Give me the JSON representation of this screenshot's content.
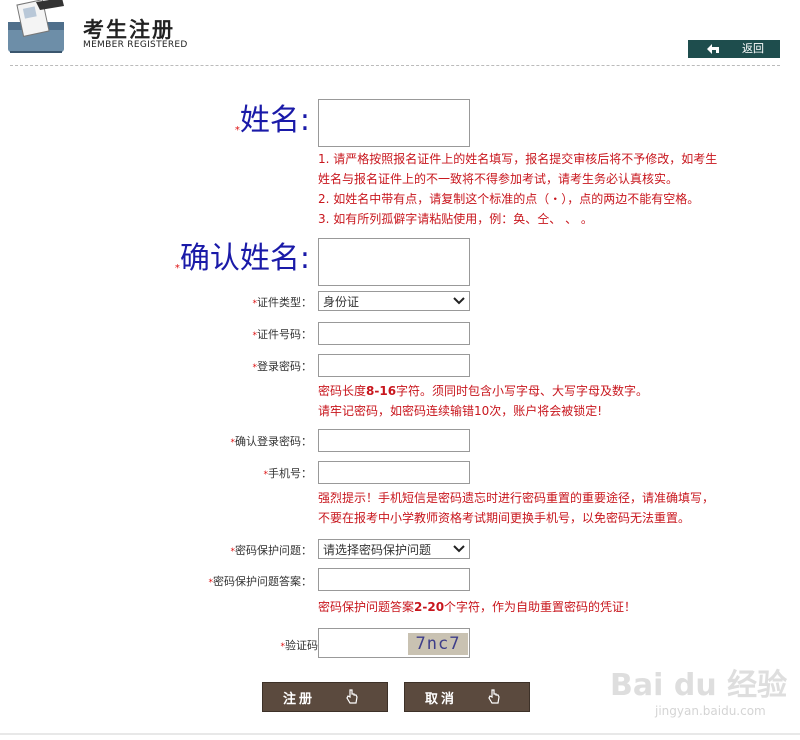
{
  "header": {
    "title_cn": "考生注册",
    "title_en": "MEMBER REGISTERED",
    "back_label": "返回"
  },
  "form": {
    "name": {
      "label": "姓名:",
      "value": "",
      "notes": [
        "1. 请严格按照报名证件上的姓名填写，报名提交审核后将不予修改，如考生",
        "姓名与报名证件上的不一致将不得参加考试，请考生务必认真核实。",
        "2. 如姓名中带有点，请复制这个标准的点（・），点的两边不能有空格。",
        "3. 如有所列孤僻字请粘贴使用，例：奂、仝、  、  。"
      ]
    },
    "confirm_name": {
      "label": "确认姓名:",
      "value": ""
    },
    "id_type": {
      "label": "证件类型：",
      "selected": "身份证"
    },
    "id_number": {
      "label": "证件号码：",
      "value": ""
    },
    "password": {
      "label": "登录密码：",
      "value": "",
      "note_line1_pre": "密码长度",
      "note_line1_bold": "8-16",
      "note_line1_post": "字符。须同时包含小写字母、大写字母及数字。",
      "note_line2": "请牢记密码，如密码连续输错10次，账户将会被锁定!"
    },
    "confirm_password": {
      "label": "确认登录密码：",
      "value": ""
    },
    "phone": {
      "label": "手机号：",
      "value": "",
      "notes": [
        "强烈提示！手机短信是密码遗忘时进行密码重置的重要途径，请准确填写，",
        "不要在报考中小学教师资格考试期间更换手机号，以免密码无法重置。"
      ]
    },
    "security_question": {
      "label": "密码保护问题：",
      "selected": "请选择密码保护问题"
    },
    "security_answer": {
      "label": "密码保护问题答案：",
      "value": "",
      "note_pre": "密码保护问题答案",
      "note_bold": "2-20",
      "note_post": "个字符，作为自助重置密码的凭证！"
    },
    "captcha": {
      "label": "验证码",
      "value": "",
      "image_text": "7nc7"
    }
  },
  "actions": {
    "register_label": "注册",
    "cancel_label": "取消"
  },
  "watermark": {
    "brand": "Bai du 经验",
    "url": "jingyan.baidu.com"
  },
  "colors": {
    "required_mark": "#dd1111",
    "note_red": "#c8161d",
    "big_label_blue": "#1a1aa8",
    "back_button_bg": "#1e4d4d",
    "action_button_bg": "#5b4a3e"
  }
}
